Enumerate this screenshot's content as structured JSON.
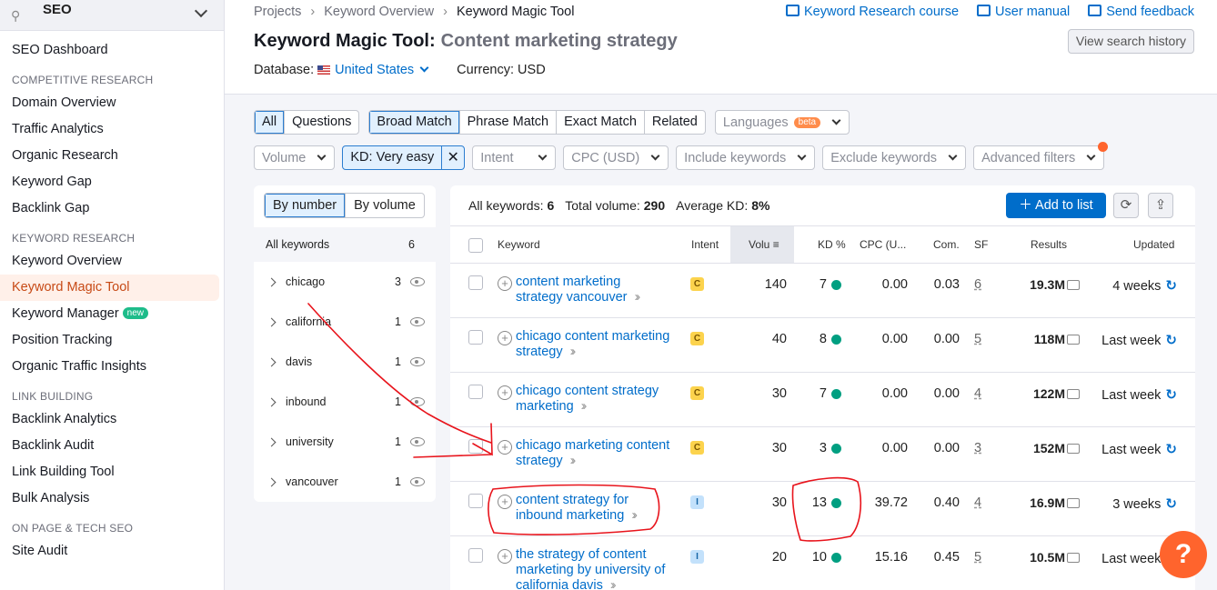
{
  "sidebar": {
    "title": "SEO",
    "dashboard": "SEO Dashboard",
    "sections": [
      {
        "heading": "COMPETITIVE RESEARCH",
        "items": [
          "Domain Overview",
          "Traffic Analytics",
          "Organic Research",
          "Keyword Gap",
          "Backlink Gap"
        ]
      },
      {
        "heading": "KEYWORD RESEARCH",
        "items": [
          "Keyword Overview",
          "Keyword Magic Tool",
          "Keyword Manager",
          "Position Tracking",
          "Organic Traffic Insights"
        ]
      },
      {
        "heading": "LINK BUILDING",
        "items": [
          "Backlink Analytics",
          "Backlink Audit",
          "Link Building Tool",
          "Bulk Analysis"
        ]
      },
      {
        "heading": "ON PAGE & TECH SEO",
        "items": [
          "Site Audit"
        ]
      }
    ],
    "new_badge": "new"
  },
  "header": {
    "breadcrumbs": [
      "Projects",
      "Keyword Overview",
      "Keyword Magic Tool"
    ],
    "links": [
      "Keyword Research course",
      "User manual",
      "Send feedback"
    ],
    "title": "Keyword Magic Tool:",
    "query": "Content marketing strategy",
    "history_button": "View search history",
    "database_label": "Database:",
    "database_value": "United States",
    "currency": "Currency: USD"
  },
  "filters": {
    "question_tabs": [
      "All",
      "Questions"
    ],
    "match_tabs": [
      "Broad Match",
      "Phrase Match",
      "Exact Match",
      "Related"
    ],
    "languages": "Languages",
    "beta": "beta",
    "volume": "Volume",
    "kd_chip": "KD: Very easy",
    "kd_clear": "✕",
    "intent": "Intent",
    "cpc": "CPC (USD)",
    "include": "Include keywords",
    "exclude": "Exclude keywords",
    "advanced": "Advanced filters"
  },
  "groups": {
    "toggle": [
      "By number",
      "By volume"
    ],
    "all_label": "All keywords",
    "all_count": "6",
    "items": [
      {
        "name": "chicago",
        "count": "3"
      },
      {
        "name": "california",
        "count": "1"
      },
      {
        "name": "davis",
        "count": "1"
      },
      {
        "name": "inbound",
        "count": "1"
      },
      {
        "name": "university",
        "count": "1"
      },
      {
        "name": "vancouver",
        "count": "1"
      }
    ]
  },
  "summary": {
    "all_label": "All keywords:",
    "all_value": "6",
    "vol_label": "Total volume:",
    "vol_value": "290",
    "kd_label": "Average KD:",
    "kd_value": "8%",
    "add_button": "＋  Add to list"
  },
  "columns": [
    "Keyword",
    "Intent",
    "Volu",
    "KD %",
    "CPC (U...",
    "Com.",
    "SF",
    "Results",
    "Updated"
  ],
  "rows": [
    {
      "kw1": "content marketing",
      "kw2": "strategy vancouver",
      "intent": "C",
      "volume": "140",
      "kd": "7",
      "cpc": "0.00",
      "com": "0.03",
      "sf": "6",
      "results": "19.3M",
      "updated": "4 weeks"
    },
    {
      "kw1": "chicago content marketing",
      "kw2": "strategy",
      "intent": "C",
      "volume": "40",
      "kd": "8",
      "cpc": "0.00",
      "com": "0.00",
      "sf": "5",
      "results": "118M",
      "updated": "Last week"
    },
    {
      "kw1": "chicago content strategy",
      "kw2": "marketing",
      "intent": "C",
      "volume": "30",
      "kd": "7",
      "cpc": "0.00",
      "com": "0.00",
      "sf": "4",
      "results": "122M",
      "updated": "Last week"
    },
    {
      "kw1": "chicago marketing content",
      "kw2": "strategy",
      "intent": "C",
      "volume": "30",
      "kd": "3",
      "cpc": "0.00",
      "com": "0.00",
      "sf": "3",
      "results": "152M",
      "updated": "Last week"
    },
    {
      "kw1": "content strategy for",
      "kw2": "inbound marketing",
      "intent": "I",
      "volume": "30",
      "kd": "13",
      "cpc": "39.72",
      "com": "0.40",
      "sf": "4",
      "results": "16.9M",
      "updated": "3 weeks"
    },
    {
      "kw1": "the strategy of content",
      "kw2": "marketing by university of california davis",
      "intent": "I",
      "volume": "20",
      "kd": "10",
      "cpc": "15.16",
      "com": "0.45",
      "sf": "5",
      "results": "10.5M",
      "updated": "Last week"
    }
  ],
  "help": "?",
  "colors": {
    "accent": "#006dca",
    "kd_dot": "#009f81",
    "annotation": "#e8141c",
    "orange": "#ff642d"
  }
}
